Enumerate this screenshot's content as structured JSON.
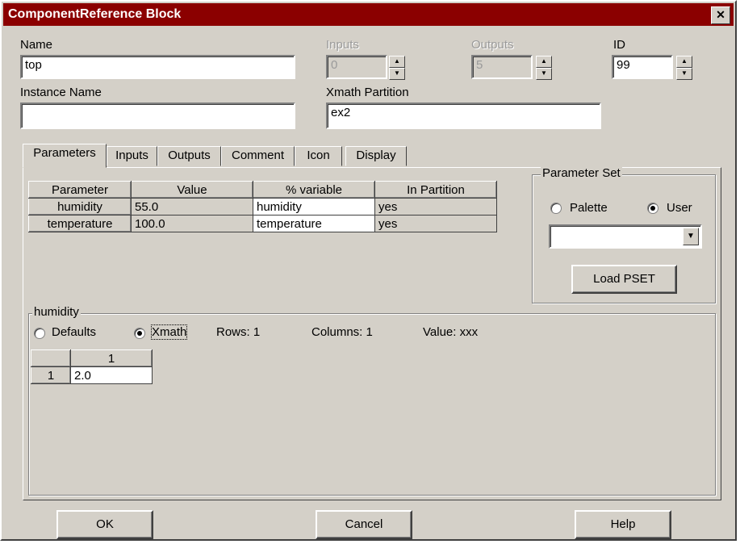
{
  "window": {
    "title": "ComponentReference Block",
    "close_glyph": "✕"
  },
  "fields": {
    "name_label": "Name",
    "name_value": "top",
    "inputs_label": "Inputs",
    "inputs_value": "0",
    "outputs_label": "Outputs",
    "outputs_value": "5",
    "id_label": "ID",
    "id_value": "99",
    "instance_label": "Instance Name",
    "instance_value": "",
    "partition_label": "Xmath Partition",
    "partition_value": "ex2"
  },
  "tabs": [
    "Parameters",
    "Inputs",
    "Outputs",
    "Comment",
    "Icon",
    "Display"
  ],
  "params_table": {
    "headers": [
      "Parameter",
      "Value",
      "% variable",
      "In Partition"
    ],
    "rows": [
      [
        "humidity",
        "55.0",
        "humidity",
        "yes"
      ],
      [
        "temperature",
        "100.0",
        "temperature",
        "yes"
      ]
    ]
  },
  "parameter_set": {
    "title": "Parameter Set",
    "palette_label": "Palette",
    "user_label": "User",
    "selected": "User",
    "combo_value": "",
    "load_button": "Load PSET"
  },
  "humidity_group": {
    "title": "humidity",
    "defaults_label": "Defaults",
    "xmath_label": "Xmath",
    "selected": "Xmath",
    "rows_text": "Rows: 1",
    "columns_text": "Columns: 1",
    "value_text": "Value:  xxx",
    "col_header": "1",
    "row_header": "1",
    "cell_value": "2.0"
  },
  "buttons": {
    "ok": "OK",
    "cancel": "Cancel",
    "help": "Help"
  },
  "icons": {
    "spin_up": "up-arrow",
    "spin_down": "down-arrow",
    "combo": "chevron-down"
  }
}
